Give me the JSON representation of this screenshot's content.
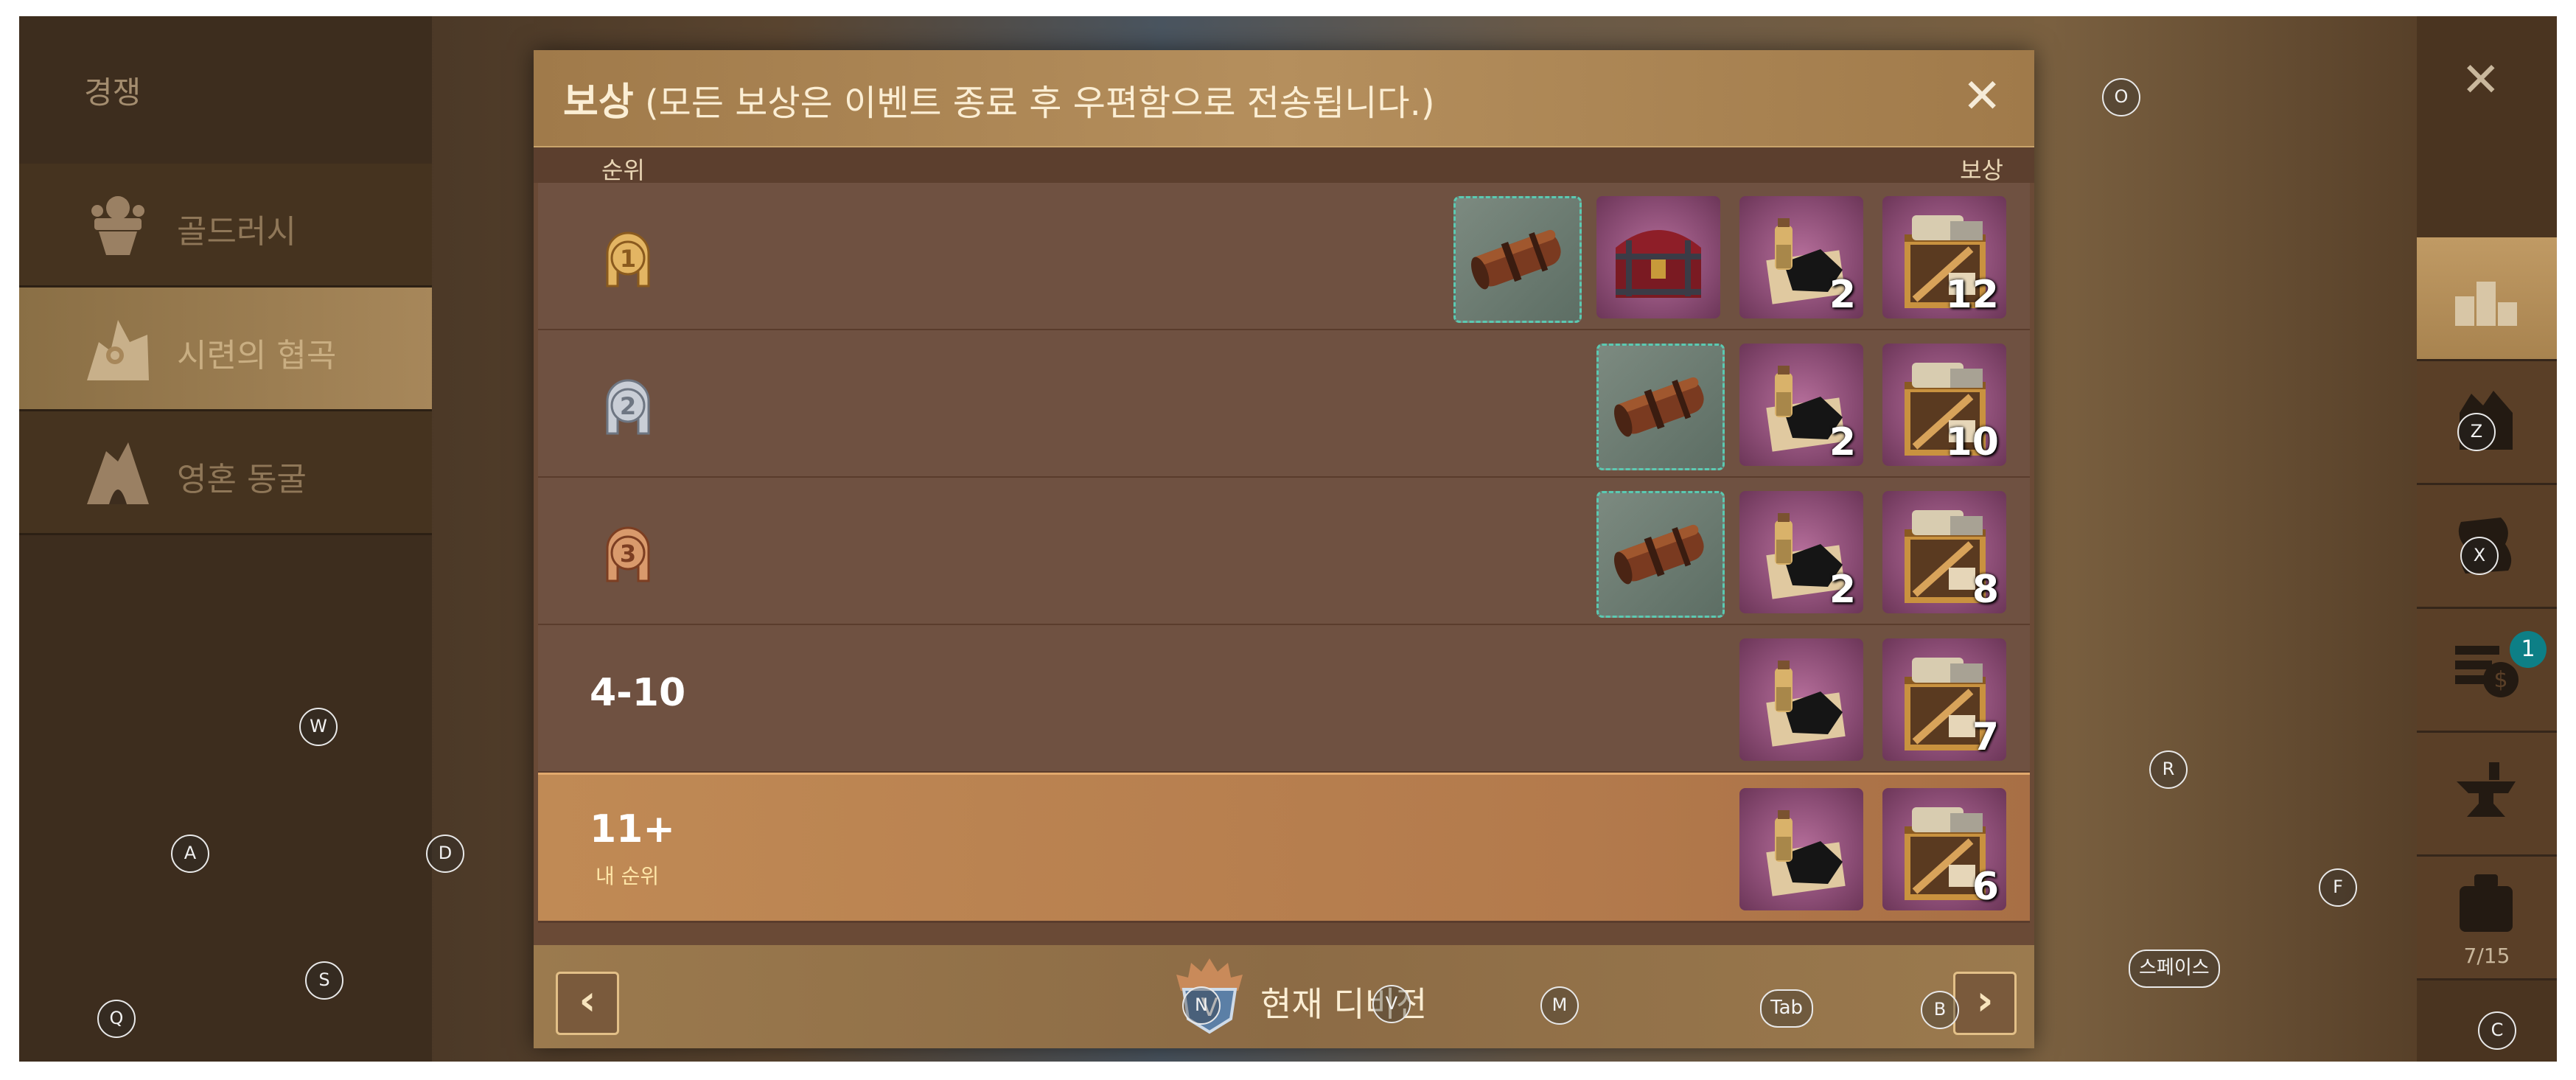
{
  "left_panel": {
    "title": "경쟁",
    "items": [
      {
        "label": "골드러시",
        "icon": "gold-rush-icon",
        "active": false
      },
      {
        "label": "시련의 협곡",
        "icon": "canyon-icon",
        "active": true
      },
      {
        "label": "영혼 동굴",
        "icon": "cave-icon",
        "active": false
      }
    ]
  },
  "modal": {
    "title_main": "보상",
    "title_note": "(모든 보상은 이벤트 종료 후 우편함으로 전송됩니다.)",
    "close_icon": "close-icon",
    "col_rank": "순위",
    "col_reward": "보상",
    "rows": [
      {
        "rank": "1",
        "medal": "gold",
        "rewards": [
          {
            "item": "scroll-case",
            "qty": ""
          },
          {
            "item": "treasure-chest",
            "qty": ""
          },
          {
            "item": "ore-potion",
            "qty": "2"
          },
          {
            "item": "material-crate",
            "qty": "12"
          }
        ]
      },
      {
        "rank": "2",
        "medal": "silver",
        "rewards": [
          {
            "item": "scroll-case",
            "qty": ""
          },
          {
            "item": "ore-potion",
            "qty": "2"
          },
          {
            "item": "material-crate",
            "qty": "10"
          }
        ]
      },
      {
        "rank": "3",
        "medal": "bronze",
        "rewards": [
          {
            "item": "scroll-case",
            "qty": ""
          },
          {
            "item": "ore-potion",
            "qty": "2"
          },
          {
            "item": "material-crate",
            "qty": "8"
          }
        ]
      },
      {
        "rank": "4-10",
        "rewards": [
          {
            "item": "ore-potion",
            "qty": ""
          },
          {
            "item": "material-crate",
            "qty": "7"
          }
        ]
      },
      {
        "rank": "11+",
        "my_rank_label": "내 순위",
        "rewards": [
          {
            "item": "ore-potion",
            "qty": ""
          },
          {
            "item": "material-crate",
            "qty": "6"
          }
        ]
      }
    ],
    "footer": {
      "prev": "‹",
      "next": "›",
      "division": "현재 디비전"
    }
  },
  "right_bar": {
    "close": "✕",
    "notification_count": "1",
    "bag_count": "7/15"
  },
  "keys": [
    "O",
    "W",
    "A",
    "D",
    "S",
    "Q",
    "N",
    "V",
    "M",
    "Tab",
    "B",
    "C",
    "R",
    "F",
    "Z",
    "X",
    "스페이스"
  ],
  "colors": {
    "modal_header": "#b58f5d",
    "my_row": "#c08a55",
    "slot_purple": "#8a4c74",
    "teal_border": "#5bc9b1",
    "badge": "#0d7f86"
  }
}
